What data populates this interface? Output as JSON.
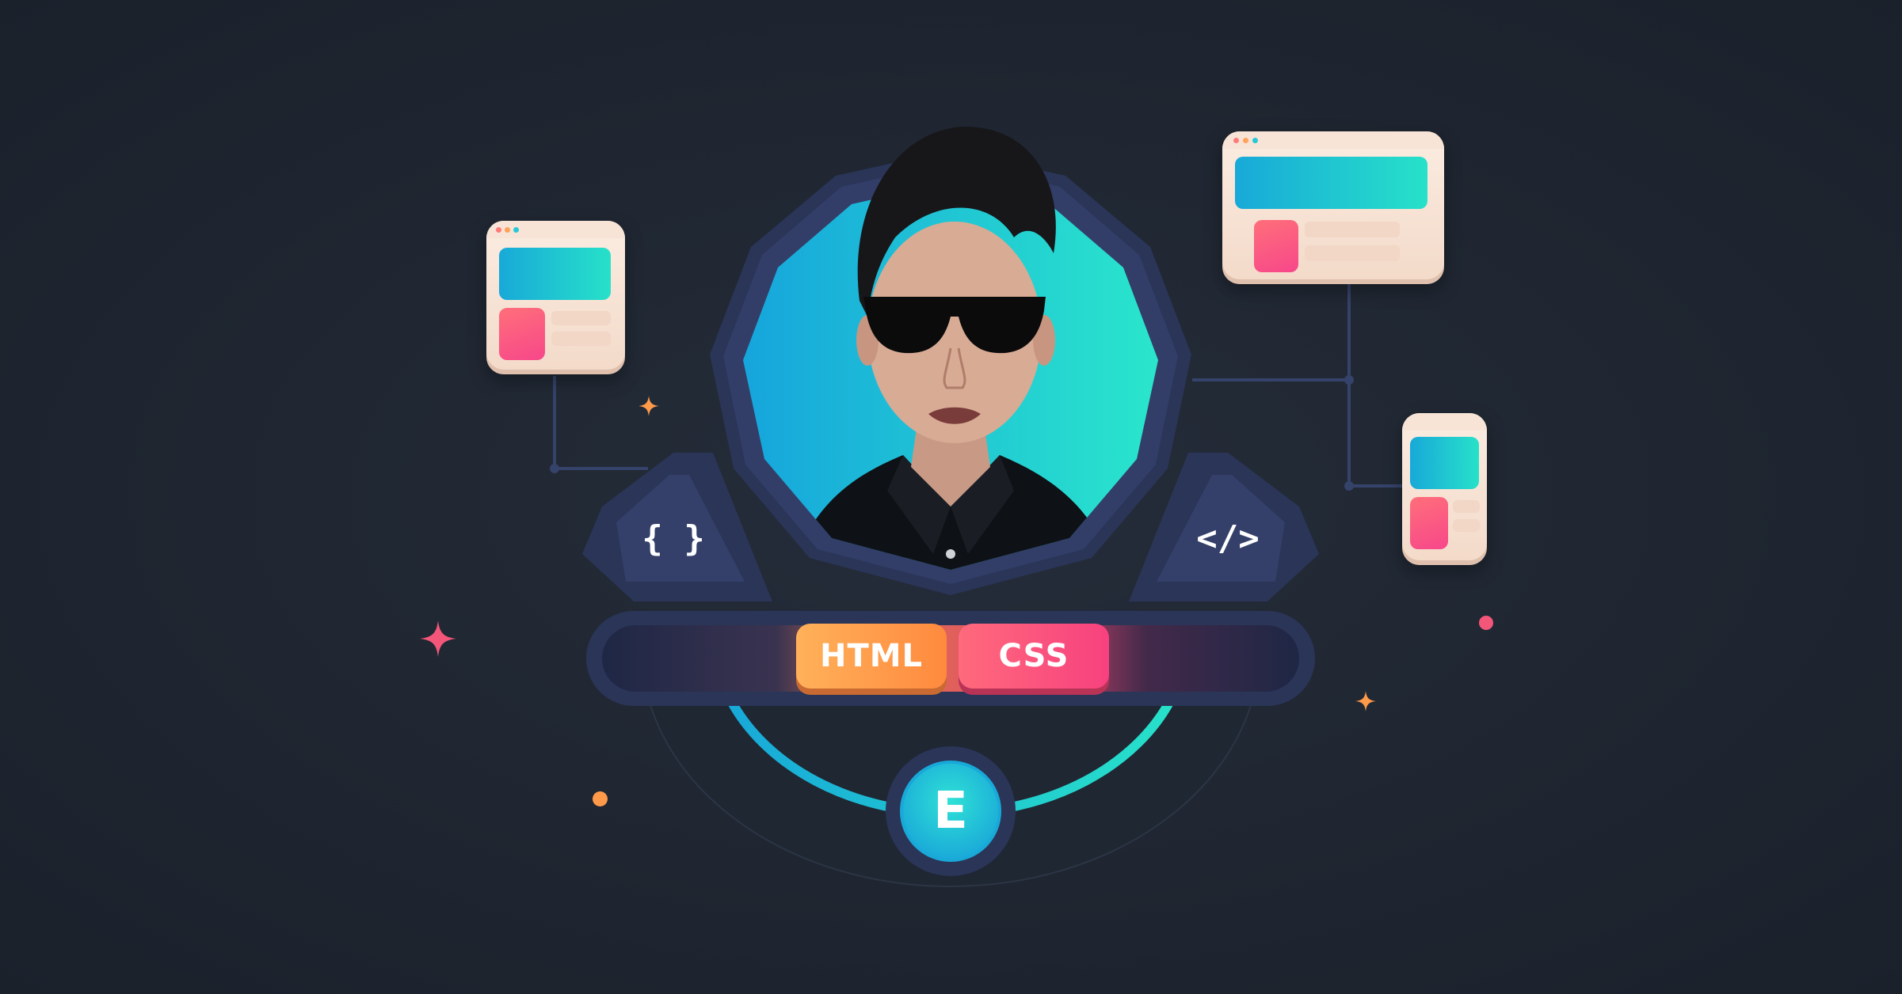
{
  "badges": {
    "html_label": "HTML",
    "css_label": "CSS"
  },
  "code_symbols": {
    "left": "{ }",
    "right": "</>"
  },
  "logo_letter": "E",
  "colors": {
    "background": "#1f2631",
    "frame": "#2a3558",
    "teal": "#27e1c9",
    "cyan": "#18a9d8",
    "orange": "#ff9a4a",
    "pink": "#f7478a"
  },
  "icons": [
    "curly-braces-icon",
    "code-tag-icon",
    "logo-e-icon",
    "sparkle-icon",
    "browser-window-icon"
  ]
}
